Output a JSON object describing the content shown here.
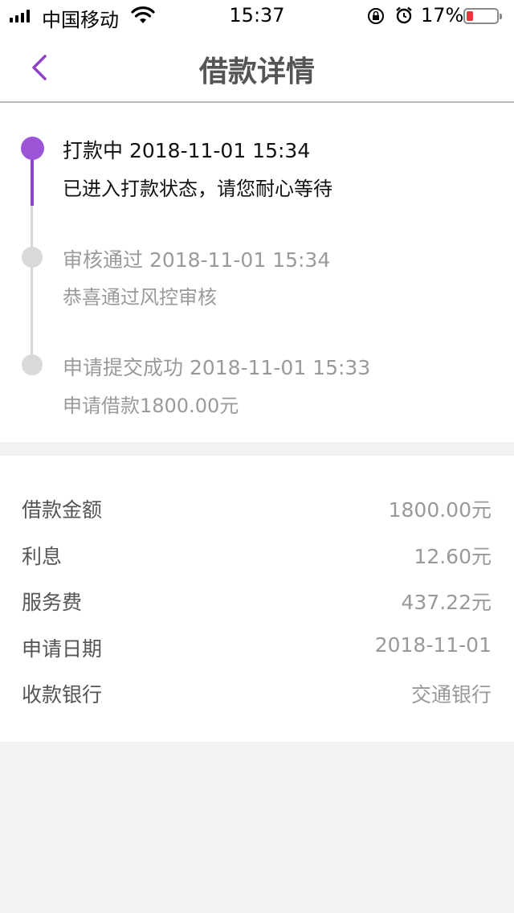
{
  "status_bar": {
    "carrier": "中国移动",
    "time": "15:37",
    "battery": "17%"
  },
  "header": {
    "title": "借款详情"
  },
  "timeline": [
    {
      "title": "打款中 2018-11-01 15:34",
      "desc": "已进入打款状态，请您耐心等待",
      "active": true
    },
    {
      "title": "审核通过 2018-11-01 15:34",
      "desc": "恭喜通过风控审核",
      "active": false
    },
    {
      "title": "申请提交成功 2018-11-01 15:33",
      "desc": "申请借款1800.00元",
      "active": false
    }
  ],
  "details": [
    {
      "label": "借款金额",
      "value": "1800.00元"
    },
    {
      "label": "利息",
      "value": "12.60元"
    },
    {
      "label": "服务费",
      "value": "437.22元"
    },
    {
      "label": "申请日期",
      "value": "2018-11-01"
    },
    {
      "label": "收款银行",
      "value": "交通银行"
    }
  ],
  "colors": {
    "accent": "#9b55d6",
    "battery_low": "#e03a3a"
  }
}
